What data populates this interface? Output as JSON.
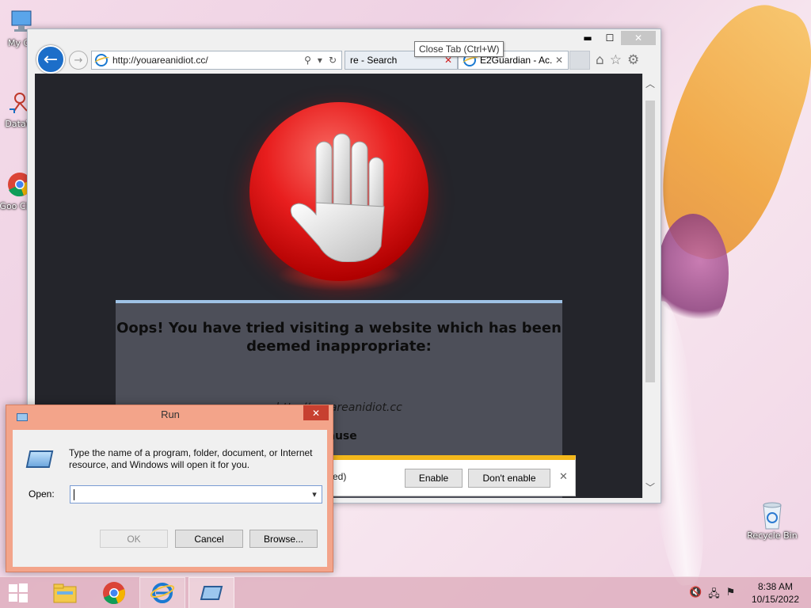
{
  "desktop": {
    "icons": [
      {
        "label": "My Co"
      },
      {
        "label": "DataW"
      },
      {
        "label": "Goo Chro"
      },
      {
        "label": "Recycle Bin"
      }
    ]
  },
  "browser": {
    "address": "http://youareanidiot.cc/",
    "tabs": [
      {
        "label": "re - Search",
        "close": "✕"
      },
      {
        "label": "E2Guardian - Ac...",
        "close": "✕"
      }
    ],
    "tooltip": "Close Tab (Ctrl+W)",
    "window_controls": {
      "minimize": "▬",
      "maximize": "☐",
      "close": "✕"
    },
    "page": {
      "heading": "Oops! You have tried visiting a website which has been deemed inappropriate:",
      "blocked_url": "http://youareanidiot.cc",
      "cause_label": "cause"
    },
    "notification": {
      "text": "ed)",
      "enable": "Enable",
      "dont_enable": "Don't enable",
      "close": "✕"
    }
  },
  "run_dialog": {
    "title": "Run",
    "description": "Type the name of a program, folder, document, or Internet resource, and Windows will open it for you.",
    "open_label": "Open:",
    "open_value": "",
    "ok": "OK",
    "cancel": "Cancel",
    "browse": "Browse..."
  },
  "taskbar": {
    "time": "8:38 AM",
    "date": "10/15/2022"
  }
}
